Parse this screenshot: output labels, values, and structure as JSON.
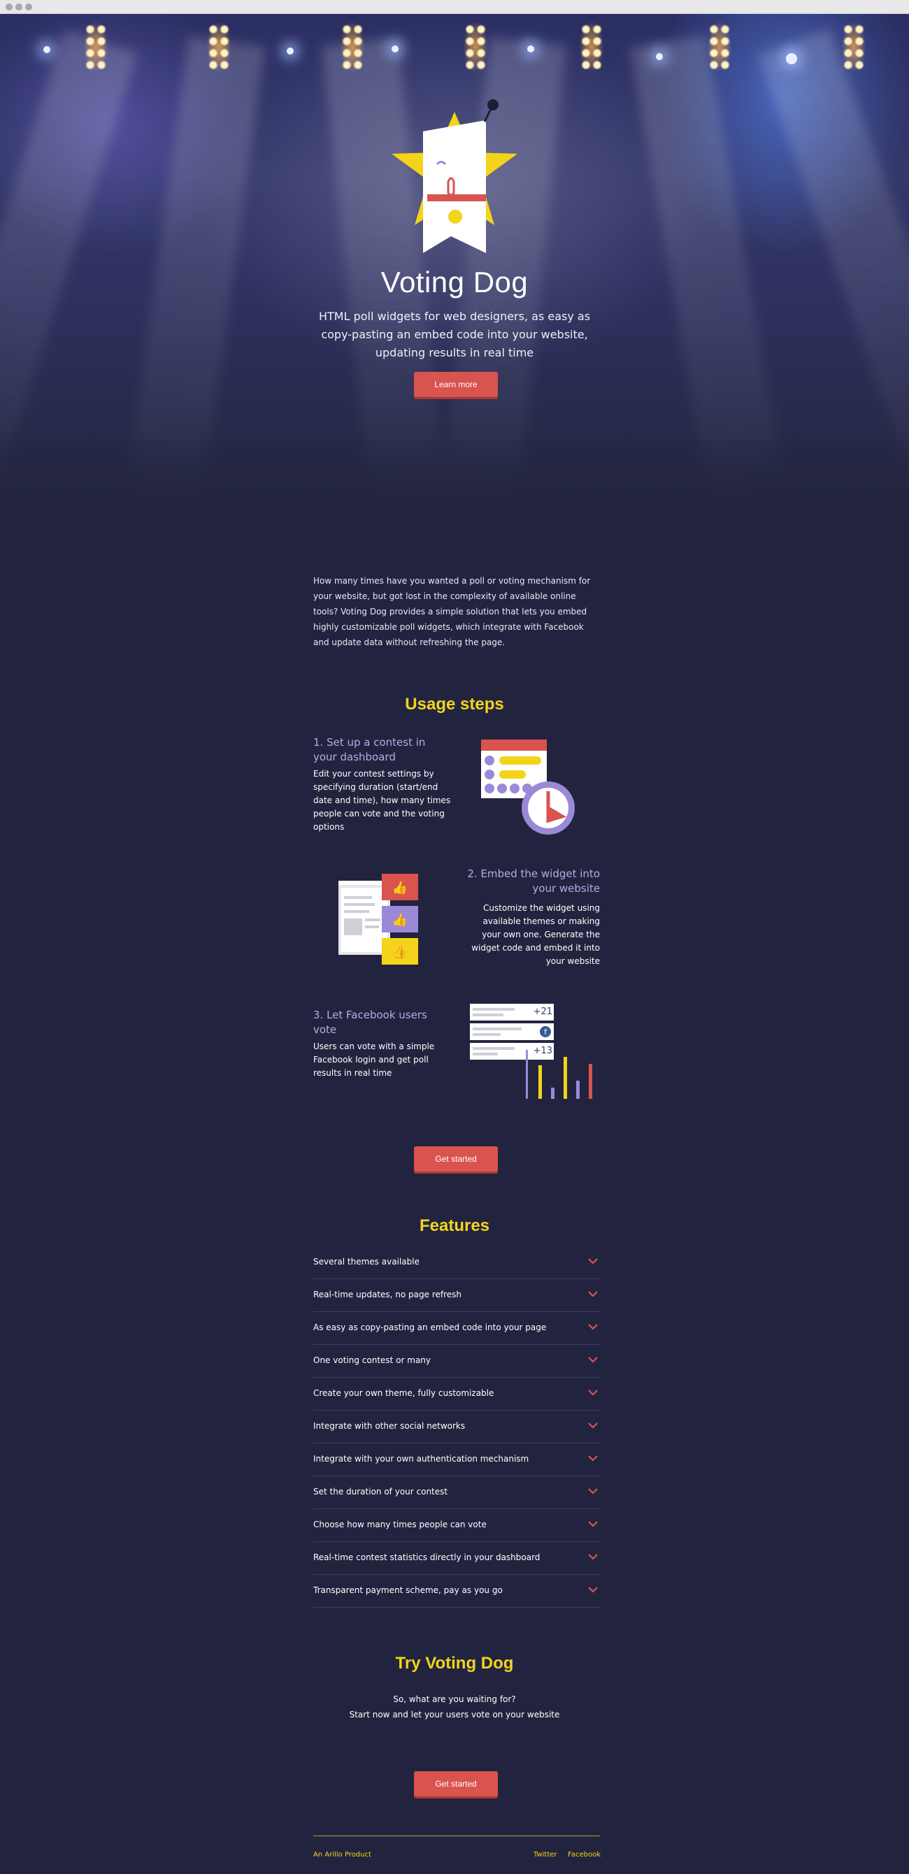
{
  "hero": {
    "title": "Voting Dog",
    "subtitle": "HTML poll widgets for web designers, as easy as copy-pasting an embed code into your website, updating results in real time",
    "cta_label": "Learn more"
  },
  "intro": {
    "text": "How many times have you wanted a poll or voting mechanism for your website, but got lost in the complexity of available online tools? Voting Dog provides a simple solution that lets you embed highly customizable poll widgets, which integrate with Facebook and update data without refreshing the page."
  },
  "usage": {
    "title": "Usage steps",
    "steps": [
      {
        "title": "1. Set up a contest in your dashboard",
        "text": "Edit your contest settings by specifying duration (start/end date and time), how many times people can vote and the voting options"
      },
      {
        "title": "2. Embed the widget into your website",
        "text": "Customize the widget using available themes or making your own one. Generate the widget code and embed it into your website"
      },
      {
        "title": "3. Let Facebook users vote",
        "text": "Users can vote with a simple Facebook login and get poll results in real time"
      }
    ],
    "vote_counts": [
      "+21",
      "+13"
    ],
    "cta_label": "Get started"
  },
  "features": {
    "title": "Features",
    "items": [
      "Several themes available",
      "Real-time updates, no page refresh",
      "As easy as copy-pasting an embed code into your page",
      "One voting contest or many",
      "Create your own theme, fully customizable",
      "Integrate with other social networks",
      "Integrate with your own authentication mechanism",
      "Set the duration of your contest",
      "Choose how many times people can vote",
      "Real-time contest statistics directly in your dashboard",
      "Transparent payment scheme, pay as you go"
    ]
  },
  "try": {
    "title": "Try Voting Dog",
    "line1": "So, what are you waiting for?",
    "line2": "Start now and let your users vote on your website",
    "cta_label": "Get started"
  },
  "footer": {
    "product": "An Arillo Product",
    "twitter": "Twitter",
    "facebook": "Facebook"
  },
  "colors": {
    "background": "#22243f",
    "accent_yellow": "#f3d41b",
    "button_red": "#d9534f",
    "step_title_purple": "#b7aae6"
  }
}
